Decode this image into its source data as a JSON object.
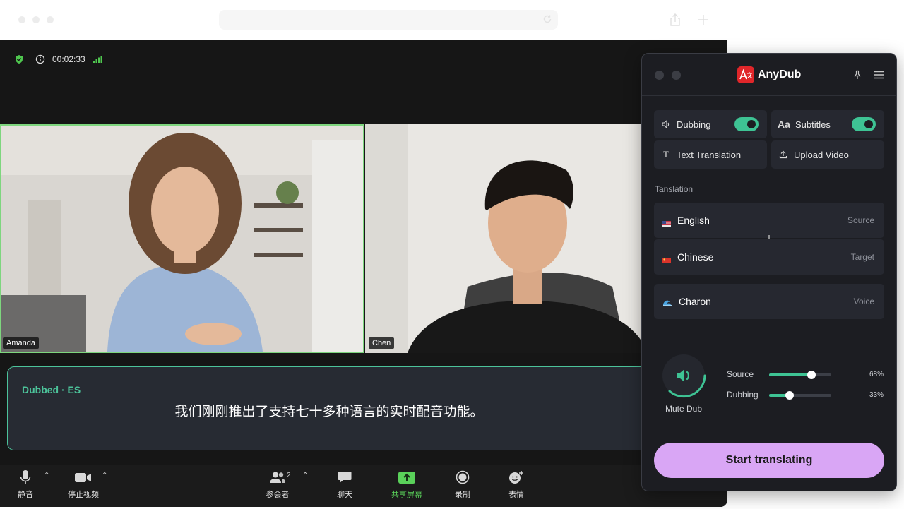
{
  "meeting": {
    "timer": "00:02:33",
    "participants": [
      {
        "name": "Amanda"
      },
      {
        "name": "Chen"
      }
    ],
    "subtitle": {
      "label": "Dubbed · ES",
      "text": "我们刚刚推出了支持七十多种语言的实时配音功能。"
    },
    "toolbar": {
      "mute": "静音",
      "stop_video": "停止视频",
      "participants_count": "2",
      "participants": "参会者",
      "chat": "聊天",
      "share_screen": "共享屏幕",
      "record": "录制",
      "reactions": "表情"
    }
  },
  "anydub": {
    "app_name": "AnyDub",
    "dubbing": {
      "label": "Dubbing",
      "enabled": true
    },
    "subtitles": {
      "label": "Subtitles",
      "enabled": true
    },
    "text_translation": "Text Translation",
    "upload_video": "Upload Video",
    "section_label": "Tanslation",
    "source": {
      "language": "English",
      "role": "Source"
    },
    "target": {
      "language": "Chinese",
      "role": "Target"
    },
    "voice": {
      "name": "Charon",
      "role": "Voice"
    },
    "mute_label": "Mute Dub",
    "volumes": [
      {
        "label": "Source",
        "value": 68,
        "display": "68%"
      },
      {
        "label": "Dubbing",
        "value": 33,
        "display": "33%"
      }
    ],
    "cta": "Start translating"
  },
  "colors": {
    "accent_green": "#3ec394",
    "active_speaker": "#7ed67e",
    "cta": "#d9a6f5",
    "panel_bg": "#1c1d22"
  }
}
